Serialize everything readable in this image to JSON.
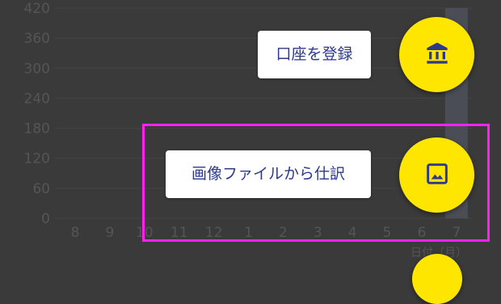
{
  "chart_data": {
    "type": "bar",
    "categories": [
      "8",
      "9",
      "10",
      "11",
      "12",
      "1",
      "2",
      "3",
      "4",
      "5",
      "6",
      "7"
    ],
    "values": [
      0,
      0,
      0,
      0,
      0,
      0,
      0,
      0,
      0,
      0,
      0,
      420
    ],
    "y_ticks": [
      "420",
      "360",
      "300",
      "240",
      "180",
      "120",
      "60",
      "0"
    ],
    "ylim": [
      0,
      420
    ],
    "xlabel": "日付（月）",
    "ylabel": "",
    "title": "",
    "grid": true
  },
  "speed_dial": {
    "items": [
      {
        "label": "口座を登録",
        "icon": "bank-icon"
      },
      {
        "label": "画像ファイルから仕訳",
        "icon": "image-icon"
      }
    ]
  },
  "colors": {
    "fab": "#ffe600",
    "highlight": "#ff21f0",
    "label_text": "#2d3a8c",
    "overlay_bg": "#3a3a3a",
    "axis_text": "#555555",
    "bar": "#4a4d55"
  }
}
